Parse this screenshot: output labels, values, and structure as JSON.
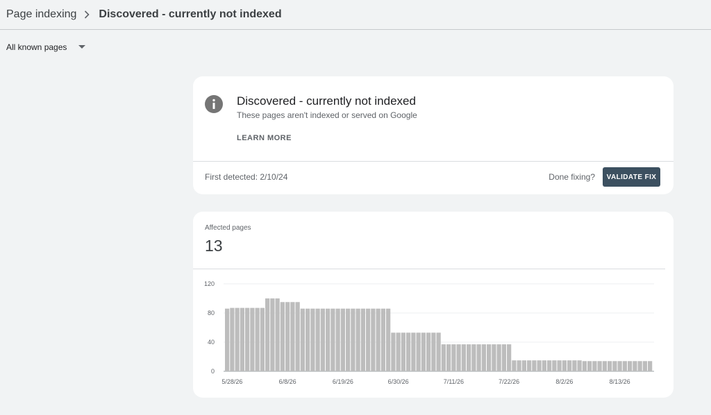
{
  "header": {
    "parent": "Page indexing",
    "current": "Discovered - currently not indexed"
  },
  "filter": {
    "selected": "All known pages"
  },
  "issue": {
    "title": "Discovered - currently not indexed",
    "description": "These pages aren't indexed or served on Google",
    "learn_more": "LEARN MORE",
    "first_detected": "First detected: 2/10/24",
    "done_fixing": "Done fixing?",
    "validate_button": "VALIDATE FIX"
  },
  "summary": {
    "label": "Affected pages",
    "count": "13"
  },
  "colors": {
    "bar": "#bdbdbd",
    "validate_button": "#3c5060",
    "info_icon": "#757575"
  },
  "chart_data": {
    "type": "bar",
    "title": "",
    "xlabel": "",
    "ylabel": "",
    "ylim": [
      0,
      120
    ],
    "yticks": [
      0,
      40,
      80,
      120
    ],
    "x_tick_labels": [
      "5/28/26",
      "6/8/26",
      "6/19/26",
      "6/30/26",
      "7/11/26",
      "7/22/26",
      "8/2/26",
      "8/13/26"
    ],
    "x_tick_indices": [
      1,
      12,
      23,
      34,
      45,
      56,
      67,
      78
    ],
    "categories": [
      "5/27/26",
      "5/28/26",
      "5/29/26",
      "5/30/26",
      "5/31/26",
      "6/1/26",
      "6/2/26",
      "6/3/26",
      "6/4/26",
      "6/5/26",
      "6/6/26",
      "6/7/26",
      "6/8/26",
      "6/9/26",
      "6/10/26",
      "6/11/26",
      "6/12/26",
      "6/13/26",
      "6/14/26",
      "6/15/26",
      "6/16/26",
      "6/17/26",
      "6/18/26",
      "6/19/26",
      "6/20/26",
      "6/21/26",
      "6/22/26",
      "6/23/26",
      "6/24/26",
      "6/25/26",
      "6/26/26",
      "6/27/26",
      "6/28/26",
      "6/29/26",
      "6/30/26",
      "7/1/26",
      "7/2/26",
      "7/3/26",
      "7/4/26",
      "7/5/26",
      "7/6/26",
      "7/7/26",
      "7/8/26",
      "7/9/26",
      "7/10/26",
      "7/11/26",
      "7/12/26",
      "7/13/26",
      "7/14/26",
      "7/15/26",
      "7/16/26",
      "7/17/26",
      "7/18/26",
      "7/19/26",
      "7/20/26",
      "7/21/26",
      "7/22/26",
      "7/23/26",
      "7/24/26",
      "7/25/26",
      "7/26/26",
      "7/27/26",
      "7/28/26",
      "7/29/26",
      "7/30/26",
      "7/31/26",
      "8/1/26",
      "8/2/26",
      "8/3/26",
      "8/4/26",
      "8/5/26",
      "8/6/26",
      "8/7/26",
      "8/8/26",
      "8/9/26",
      "8/10/26",
      "8/11/26",
      "8/12/26",
      "8/13/26",
      "8/14/26",
      "8/15/26",
      "8/16/26",
      "8/17/26",
      "8/18/26",
      "8/19/26",
      "8/20/26"
    ],
    "values": [
      86,
      87,
      87,
      87,
      87,
      87,
      87,
      87,
      100,
      100,
      100,
      95,
      95,
      95,
      95,
      86,
      86,
      86,
      86,
      86,
      86,
      86,
      86,
      86,
      86,
      86,
      86,
      86,
      86,
      86,
      86,
      86,
      86,
      53,
      53,
      53,
      53,
      53,
      53,
      53,
      53,
      53,
      53,
      37,
      37,
      37,
      37,
      37,
      37,
      37,
      37,
      37,
      37,
      37,
      37,
      37,
      37,
      15,
      15,
      15,
      15,
      15,
      15,
      15,
      15,
      15,
      15,
      15,
      15,
      15,
      15,
      14,
      14,
      14,
      14,
      14,
      14,
      14,
      14,
      14,
      14,
      14,
      14,
      14,
      14
    ]
  }
}
